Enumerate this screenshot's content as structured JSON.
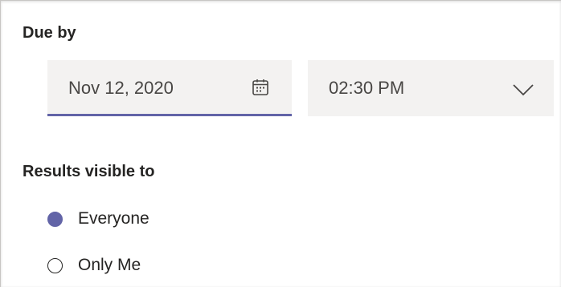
{
  "due": {
    "label": "Due by",
    "date_value": "Nov 12, 2020",
    "time_value": "02:30 PM",
    "calendar_icon": "calendar-icon",
    "dropdown_icon": "chevron-down-icon"
  },
  "results": {
    "label": "Results visible to",
    "options": [
      {
        "label": "Everyone",
        "checked": true
      },
      {
        "label": "Only Me",
        "checked": false
      }
    ]
  },
  "colors": {
    "accent": "#6264a7",
    "field_bg": "#f3f2f1",
    "text": "#252423"
  }
}
